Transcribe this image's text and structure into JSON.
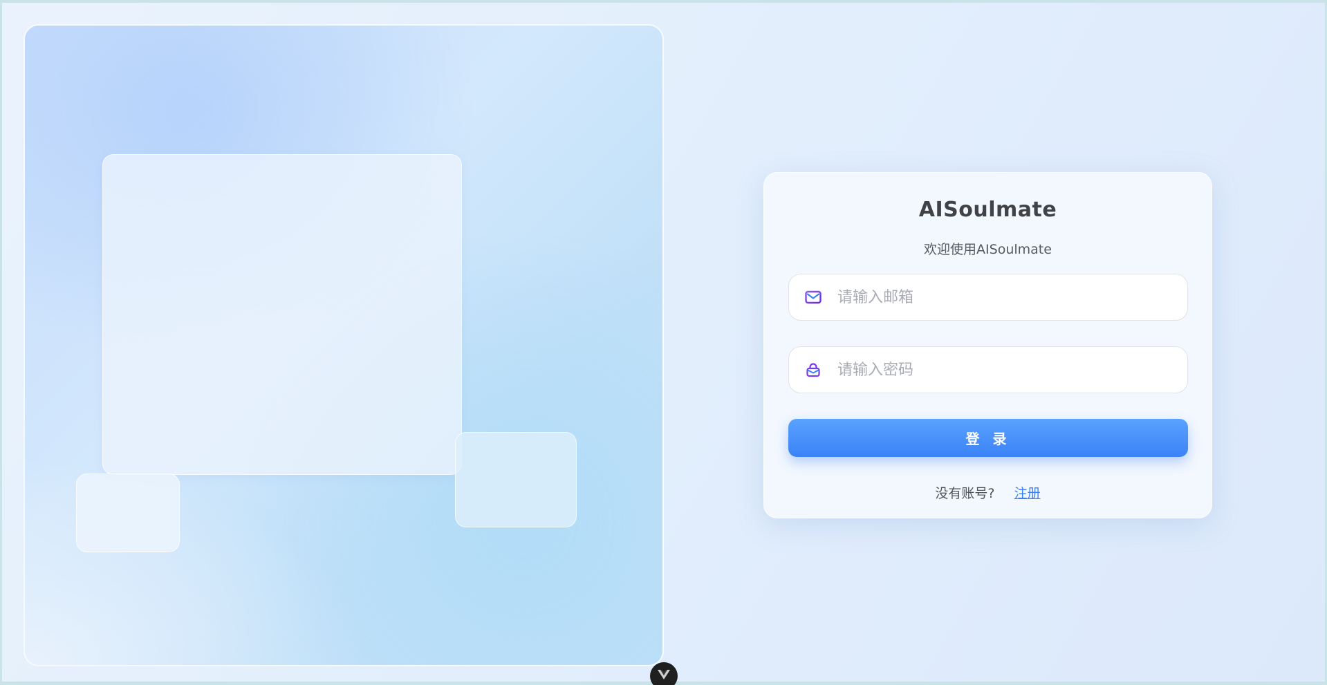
{
  "brand": {
    "title": "AISoulmate",
    "welcome": "欢迎使用AISoulmate"
  },
  "form": {
    "email_placeholder": "请输入邮箱",
    "email_value": "",
    "email_icon": "mail-icon",
    "password_placeholder": "请输入密码",
    "password_value": "",
    "password_icon": "lock-icon",
    "login_label": "登 录",
    "no_account_text": "没有账号?",
    "register_label": "注册"
  },
  "colors": {
    "accent": "#3b82f6",
    "icon": "#7c3aed"
  },
  "devtools": {
    "icon": "vue-devtools-icon"
  }
}
